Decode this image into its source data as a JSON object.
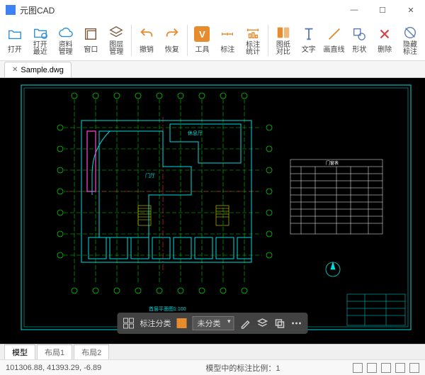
{
  "app": {
    "title": "元图CAD"
  },
  "ribbon": {
    "open": "打开",
    "open_recent": "打开\n最近",
    "data_mgmt": "资料\n管理",
    "window": "窗口",
    "layer_mgmt": "图层\n管理",
    "undo": "撤销",
    "redo": "恢复",
    "tools": "工具",
    "annotate": "标注",
    "annotate_stats": "标注\n统计",
    "drawing_compare": "图纸\n对比",
    "text": "文字",
    "draw_line": "画直线",
    "shape": "形状",
    "delete": "删除",
    "hide_annotation": "隐藏\n标注"
  },
  "tabs": {
    "file": "Sample.dwg"
  },
  "drawing": {
    "room1": "休息厅",
    "room2": "门厅",
    "title": "首层平面图1:100",
    "table_title": "门窗表"
  },
  "floatbar": {
    "label_category": "标注分类",
    "uncategorized": "未分类"
  },
  "bottom_tabs": {
    "model": "模型",
    "layout1": "布局1",
    "layout2": "布局2"
  },
  "status": {
    "coords": "101306.88,  41393.29,  -6.89",
    "ratio": "模型中的标注比例：1"
  }
}
